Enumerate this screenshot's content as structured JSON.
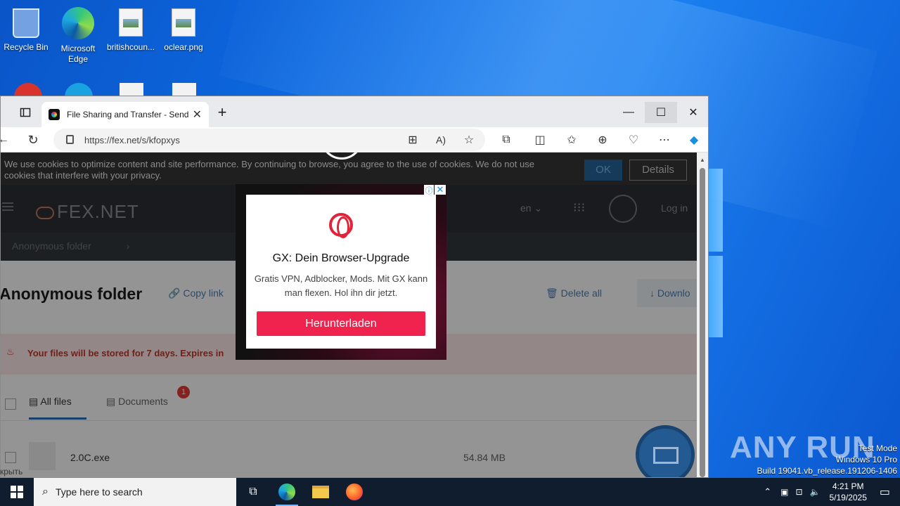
{
  "desktop": {
    "icons": [
      {
        "label": "Recycle Bin"
      },
      {
        "label": "Microsoft Edge"
      },
      {
        "label": "britishcoun..."
      },
      {
        "label": "oclear.png"
      }
    ]
  },
  "browser": {
    "tab_title": "File Sharing and Transfer - Send L",
    "url": "https://fex.net/s/kfopxys",
    "controls": {
      "minimize": "—",
      "maximize": "☐",
      "close": "✕",
      "new_tab": "+"
    }
  },
  "page": {
    "cookie_text": "We use cookies to optimize content and site performance. By continuing to browse, you agree to the use of cookies. We do not use cookies that interfere with your privacy.",
    "cookie_ok": "OK",
    "cookie_details": "Details",
    "logo": "FEX.NET",
    "lang": "en",
    "login": "Log in",
    "breadcrumb": "Anonymous folder",
    "folder_title": "Anonymous folder",
    "copy_link": "Copy link",
    "delete_all": "Delete all",
    "download": "Downlo",
    "warning": "Your files will be stored for 7 days. Expires in",
    "tabs": [
      {
        "label": "All files"
      },
      {
        "label": "Documents",
        "badge": "1"
      }
    ],
    "file": {
      "name": "2.0C.exe",
      "size": "54.84 MB"
    },
    "side_text": "крыть"
  },
  "ad": {
    "title": "GX: Dein Browser-Upgrade",
    "body": "Gratis VPN, Adblocker, Mods. Mit GX kann man flexen. Hol ihn dir jetzt.",
    "button": "Herunterladen",
    "accent": "#f0234f"
  },
  "taskbar": {
    "search_placeholder": "Type here to search",
    "time": "4:21 PM",
    "date": "5/19/2025"
  },
  "system": {
    "test_mode": "Test Mode",
    "edition": "Windows 10 Pro",
    "build": "Build 19041.vb_release.191206-1406",
    "watermark": "ANY RUN"
  }
}
